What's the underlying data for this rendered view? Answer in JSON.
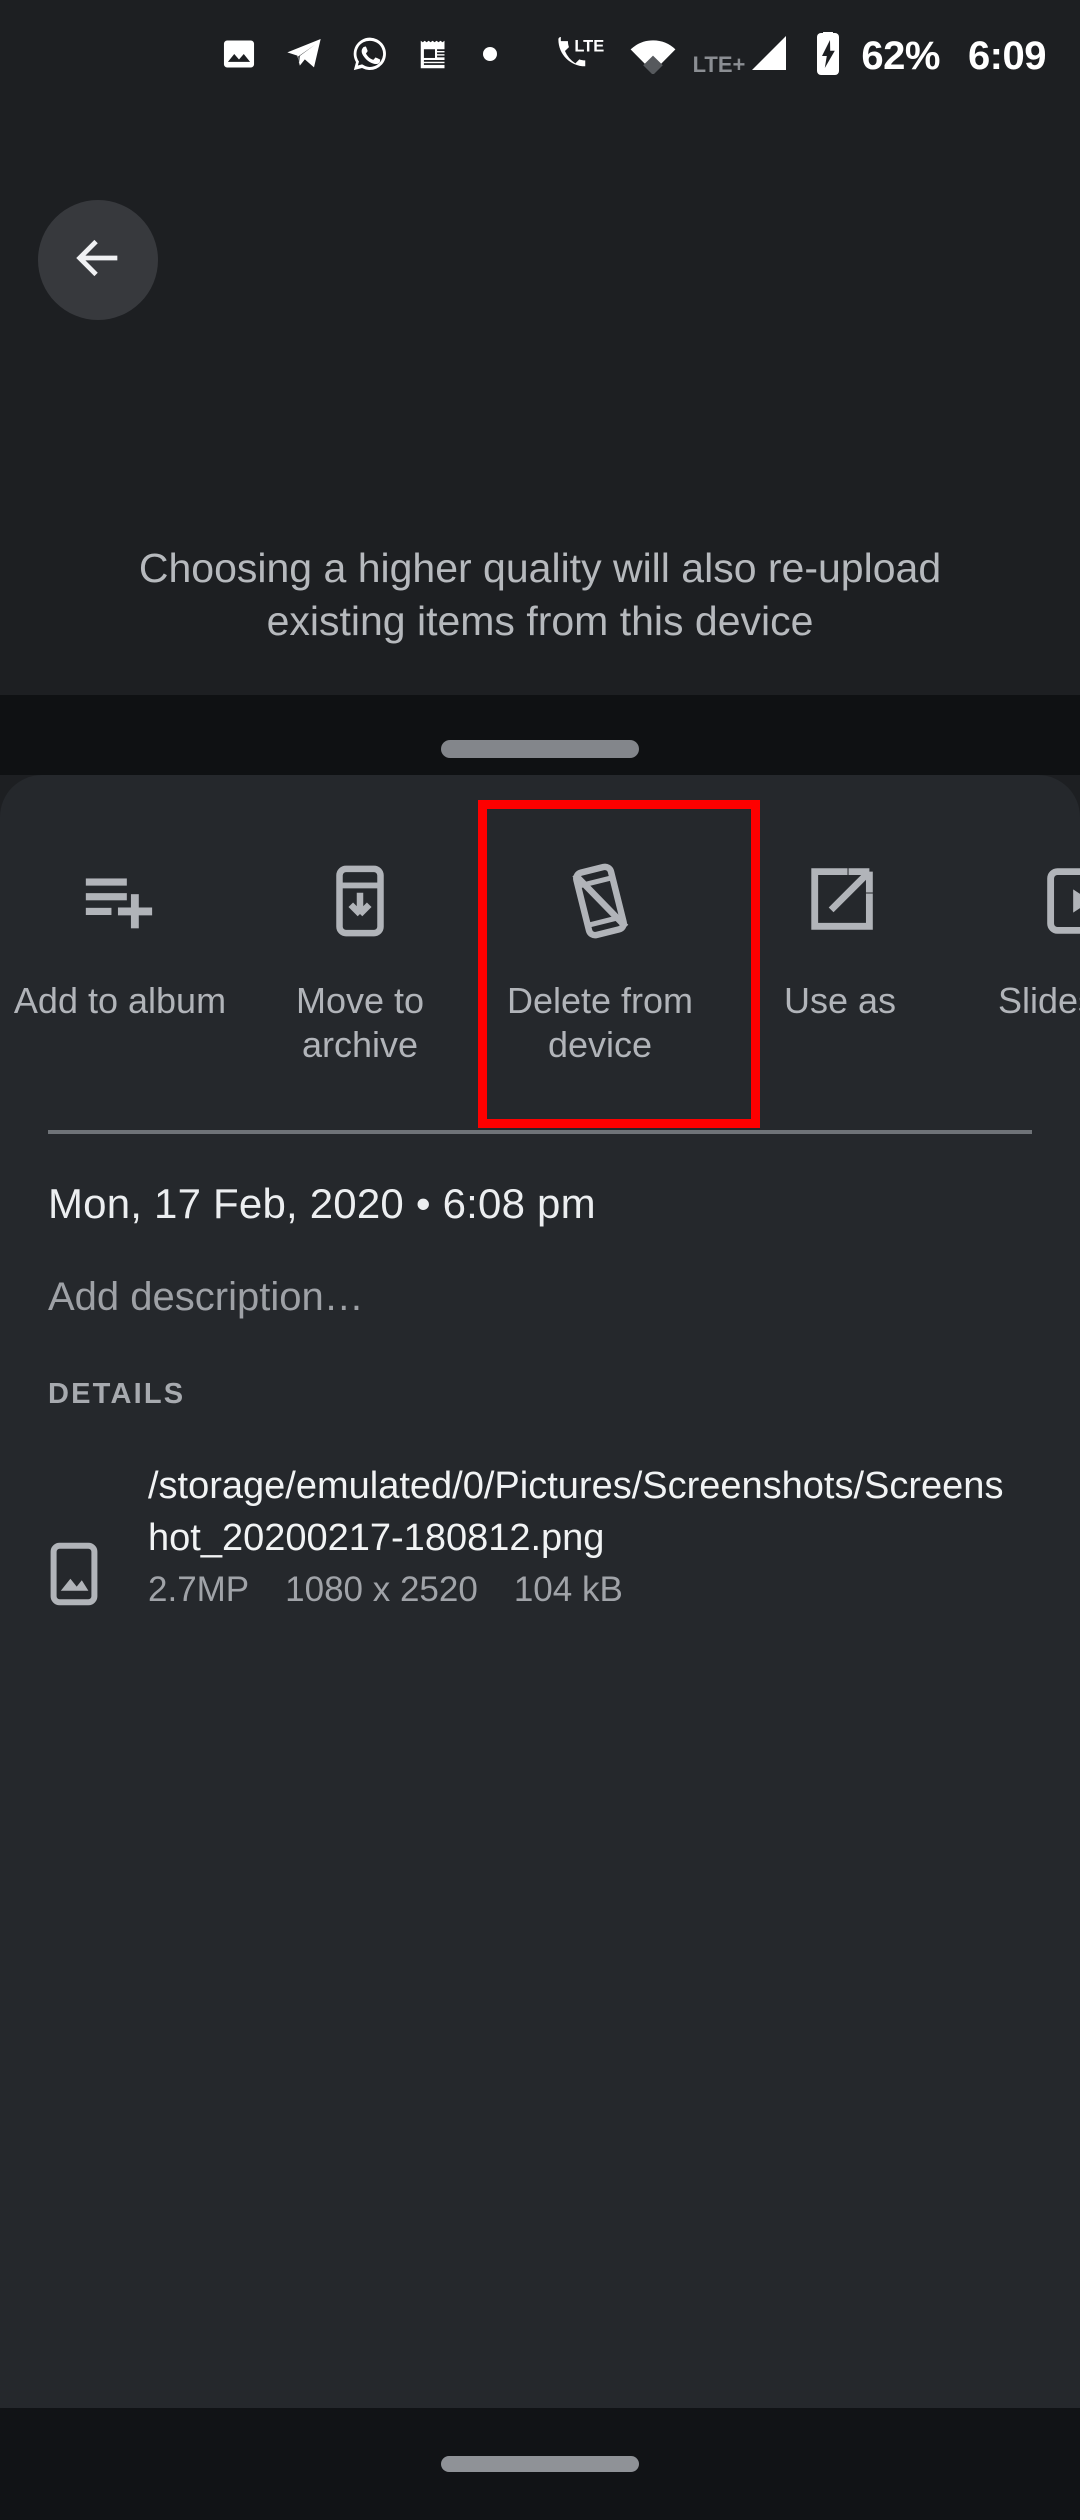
{
  "status_bar": {
    "notification_icons": [
      "photo-icon",
      "telegram-icon",
      "whatsapp-icon",
      "news-icon",
      "dot-icon"
    ],
    "system_icons": [
      "call-lte-icon",
      "wifi-icon",
      "signal-icon",
      "battery-charging-icon"
    ],
    "network_label": "LTE",
    "network_label_secondary": "LTE+",
    "battery_percent": "62%",
    "clock": "6:09"
  },
  "backdrop": {
    "back_icon": "arrow-back-icon",
    "message_line1": "Choosing a higher quality will also re-upload",
    "message_line2": "existing items from this device"
  },
  "sheet": {
    "handle": "drag-handle",
    "actions": [
      {
        "label": "Add to album",
        "icon": "playlist-add-icon"
      },
      {
        "label": "Move to archive",
        "icon": "archive-icon"
      },
      {
        "label": "Delete from device",
        "icon": "phone-delete-icon"
      },
      {
        "label": "Use as",
        "icon": "open-in-new-icon"
      },
      {
        "label": "Slideshow",
        "icon": "slideshow-icon"
      }
    ],
    "date_time": "Mon, 17 Feb, 2020  •  6:08 pm",
    "description_placeholder": "Add description…",
    "details_heading": "DETAILS",
    "details": {
      "icon": "image-file-icon",
      "file_path": "/storage/emulated/0/Pictures/Screenshots/Screenshot_20200217-180812.png",
      "megapixels": "2.7MP",
      "dimensions": "1080 x 2520",
      "file_size": "104 kB"
    }
  },
  "annotation": {
    "highlight_target": "Delete from device",
    "highlight_color": "#fe0000"
  },
  "nav_bar": {
    "gesture_pill": "home-gesture-pill"
  },
  "colors": {
    "background": "#1d1f22",
    "sheet": "#25282c",
    "scrim": "#0f1113",
    "nav": "#111316",
    "text_primary": "#f1f3f4",
    "text_secondary": "#a0a3a8",
    "icon": "#b1b4b9"
  }
}
